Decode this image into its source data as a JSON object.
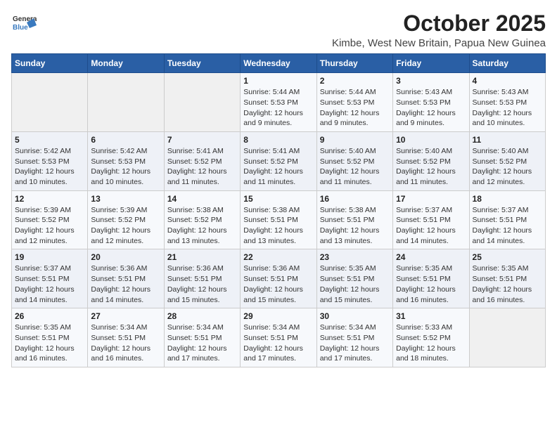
{
  "logo": {
    "general": "General",
    "blue": "Blue"
  },
  "title": "October 2025",
  "subtitle": "Kimbe, West New Britain, Papua New Guinea",
  "days_of_week": [
    "Sunday",
    "Monday",
    "Tuesday",
    "Wednesday",
    "Thursday",
    "Friday",
    "Saturday"
  ],
  "weeks": [
    [
      {
        "day": "",
        "info": ""
      },
      {
        "day": "",
        "info": ""
      },
      {
        "day": "",
        "info": ""
      },
      {
        "day": "1",
        "info": "Sunrise: 5:44 AM\nSunset: 5:53 PM\nDaylight: 12 hours and 9 minutes."
      },
      {
        "day": "2",
        "info": "Sunrise: 5:44 AM\nSunset: 5:53 PM\nDaylight: 12 hours and 9 minutes."
      },
      {
        "day": "3",
        "info": "Sunrise: 5:43 AM\nSunset: 5:53 PM\nDaylight: 12 hours and 9 minutes."
      },
      {
        "day": "4",
        "info": "Sunrise: 5:43 AM\nSunset: 5:53 PM\nDaylight: 12 hours and 10 minutes."
      }
    ],
    [
      {
        "day": "5",
        "info": "Sunrise: 5:42 AM\nSunset: 5:53 PM\nDaylight: 12 hours and 10 minutes."
      },
      {
        "day": "6",
        "info": "Sunrise: 5:42 AM\nSunset: 5:53 PM\nDaylight: 12 hours and 10 minutes."
      },
      {
        "day": "7",
        "info": "Sunrise: 5:41 AM\nSunset: 5:52 PM\nDaylight: 12 hours and 11 minutes."
      },
      {
        "day": "8",
        "info": "Sunrise: 5:41 AM\nSunset: 5:52 PM\nDaylight: 12 hours and 11 minutes."
      },
      {
        "day": "9",
        "info": "Sunrise: 5:40 AM\nSunset: 5:52 PM\nDaylight: 12 hours and 11 minutes."
      },
      {
        "day": "10",
        "info": "Sunrise: 5:40 AM\nSunset: 5:52 PM\nDaylight: 12 hours and 11 minutes."
      },
      {
        "day": "11",
        "info": "Sunrise: 5:40 AM\nSunset: 5:52 PM\nDaylight: 12 hours and 12 minutes."
      }
    ],
    [
      {
        "day": "12",
        "info": "Sunrise: 5:39 AM\nSunset: 5:52 PM\nDaylight: 12 hours and 12 minutes."
      },
      {
        "day": "13",
        "info": "Sunrise: 5:39 AM\nSunset: 5:52 PM\nDaylight: 12 hours and 12 minutes."
      },
      {
        "day": "14",
        "info": "Sunrise: 5:38 AM\nSunset: 5:52 PM\nDaylight: 12 hours and 13 minutes."
      },
      {
        "day": "15",
        "info": "Sunrise: 5:38 AM\nSunset: 5:51 PM\nDaylight: 12 hours and 13 minutes."
      },
      {
        "day": "16",
        "info": "Sunrise: 5:38 AM\nSunset: 5:51 PM\nDaylight: 12 hours and 13 minutes."
      },
      {
        "day": "17",
        "info": "Sunrise: 5:37 AM\nSunset: 5:51 PM\nDaylight: 12 hours and 14 minutes."
      },
      {
        "day": "18",
        "info": "Sunrise: 5:37 AM\nSunset: 5:51 PM\nDaylight: 12 hours and 14 minutes."
      }
    ],
    [
      {
        "day": "19",
        "info": "Sunrise: 5:37 AM\nSunset: 5:51 PM\nDaylight: 12 hours and 14 minutes."
      },
      {
        "day": "20",
        "info": "Sunrise: 5:36 AM\nSunset: 5:51 PM\nDaylight: 12 hours and 14 minutes."
      },
      {
        "day": "21",
        "info": "Sunrise: 5:36 AM\nSunset: 5:51 PM\nDaylight: 12 hours and 15 minutes."
      },
      {
        "day": "22",
        "info": "Sunrise: 5:36 AM\nSunset: 5:51 PM\nDaylight: 12 hours and 15 minutes."
      },
      {
        "day": "23",
        "info": "Sunrise: 5:35 AM\nSunset: 5:51 PM\nDaylight: 12 hours and 15 minutes."
      },
      {
        "day": "24",
        "info": "Sunrise: 5:35 AM\nSunset: 5:51 PM\nDaylight: 12 hours and 16 minutes."
      },
      {
        "day": "25",
        "info": "Sunrise: 5:35 AM\nSunset: 5:51 PM\nDaylight: 12 hours and 16 minutes."
      }
    ],
    [
      {
        "day": "26",
        "info": "Sunrise: 5:35 AM\nSunset: 5:51 PM\nDaylight: 12 hours and 16 minutes."
      },
      {
        "day": "27",
        "info": "Sunrise: 5:34 AM\nSunset: 5:51 PM\nDaylight: 12 hours and 16 minutes."
      },
      {
        "day": "28",
        "info": "Sunrise: 5:34 AM\nSunset: 5:51 PM\nDaylight: 12 hours and 17 minutes."
      },
      {
        "day": "29",
        "info": "Sunrise: 5:34 AM\nSunset: 5:51 PM\nDaylight: 12 hours and 17 minutes."
      },
      {
        "day": "30",
        "info": "Sunrise: 5:34 AM\nSunset: 5:51 PM\nDaylight: 12 hours and 17 minutes."
      },
      {
        "day": "31",
        "info": "Sunrise: 5:33 AM\nSunset: 5:52 PM\nDaylight: 12 hours and 18 minutes."
      },
      {
        "day": "",
        "info": ""
      }
    ]
  ]
}
